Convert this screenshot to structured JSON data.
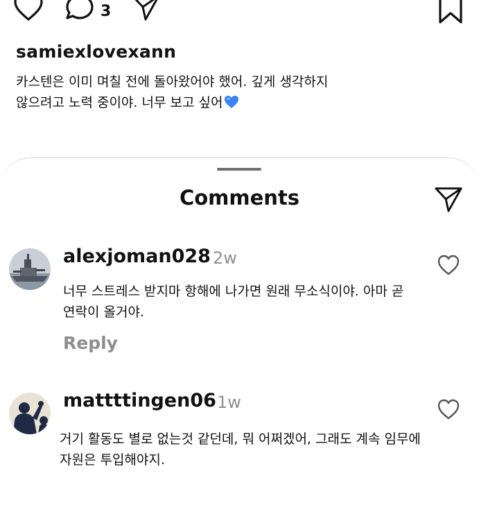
{
  "post": {
    "comment_count": "3",
    "username": "samiexlovexann",
    "caption_line1": "카스텐은 이미 며칠 전에 돌아왔어야 했어.  깊게 생각하지",
    "caption_line2": "않으려고 노력 중이야. 너무 보고 싶어"
  },
  "sheet": {
    "title": "Comments"
  },
  "comments": [
    {
      "username": "alexjoman028",
      "time": "2w",
      "text_line1": "너무 스트레스 받지마 항해에 나가면 원래 무소식이야. 아마 곧",
      "text_line2": "연락이 올거야.",
      "reply_label": "Reply"
    },
    {
      "username": "mattttingen06",
      "time": "1w",
      "text_line1": "거기 활동도 별로 없는것 같던데, 뭐 어쩌겠어, 그래도 계속 임무에",
      "text_line2": "자원은 투입해야지."
    }
  ],
  "icons": {
    "like": "heart-icon",
    "comment": "comment-bubble-icon",
    "share": "paper-plane-icon",
    "save": "bookmark-icon",
    "emoji": "blue-heart-emoji"
  },
  "colors": {
    "text": "#111111",
    "muted": "#8e8e8e",
    "emoji_blue": "#3b82f6"
  }
}
